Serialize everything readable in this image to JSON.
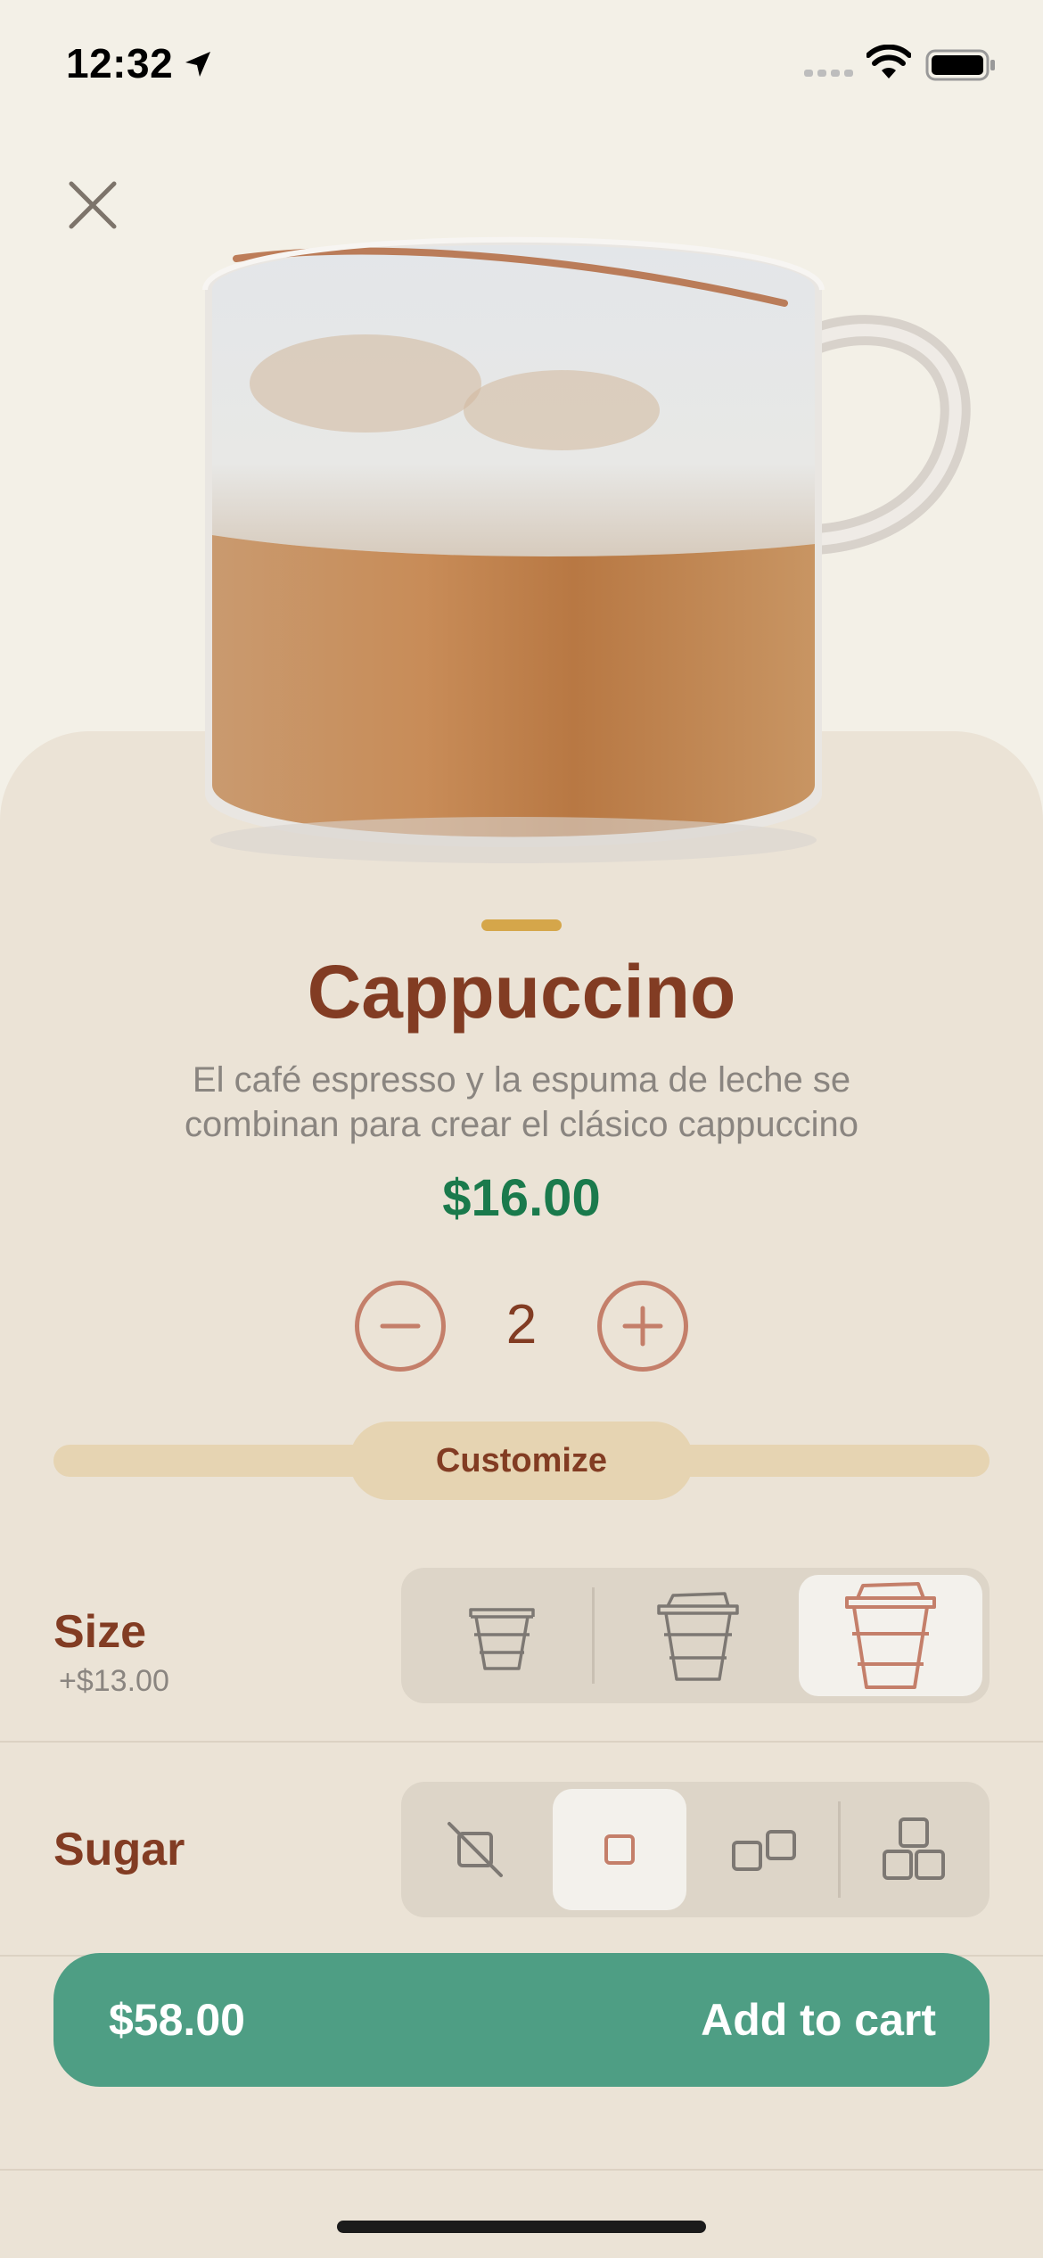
{
  "status_bar": {
    "time": "12:32",
    "icons": [
      "location-arrow-icon",
      "signal-icon",
      "wifi-icon",
      "battery-icon"
    ]
  },
  "navigation": {
    "close_icon": "close-icon"
  },
  "product": {
    "name": "Cappuccino",
    "description": "El café espresso y la espuma de leche se combinan para crear el clásico cappuccino",
    "price": "$16.00",
    "image_icon": "cappuccino-cup-image"
  },
  "quantity": {
    "value": "2",
    "decrement_icon": "minus-icon",
    "increment_icon": "plus-icon"
  },
  "customize": {
    "label": "Customize"
  },
  "options": {
    "size": {
      "label": "Size",
      "extra": "+$13.00",
      "choices": [
        "small-cup-icon",
        "medium-cup-icon",
        "large-cup-icon"
      ],
      "selected_index": 2
    },
    "sugar": {
      "label": "Sugar",
      "choices": [
        "no-sugar-icon",
        "one-sugar-cube-icon",
        "two-sugar-cubes-icon",
        "three-sugar-cubes-icon"
      ],
      "selected_index": 1
    }
  },
  "cart": {
    "total": "$58.00",
    "label": "Add to cart"
  },
  "colors": {
    "background": "#f3f0e7",
    "sheet": "#ebe3d6",
    "brown": "#823c23",
    "green_price": "#1a7a4c",
    "cta_green": "#4e9e84",
    "accent_tan": "#e6d4b2",
    "icon_copper": "#c47f6a"
  }
}
